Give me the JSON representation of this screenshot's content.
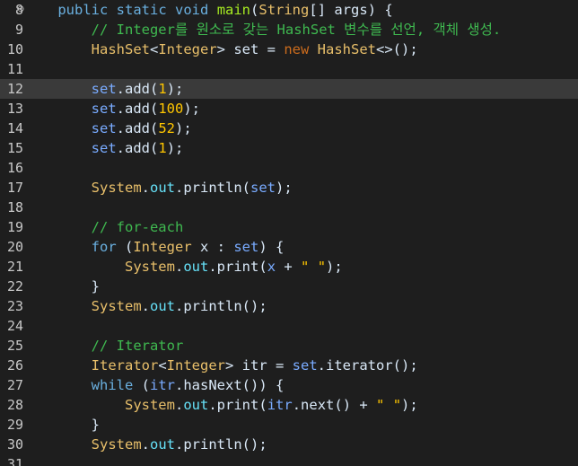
{
  "editor": {
    "lines": [
      {
        "num": "8",
        "marker": "⊖",
        "current": false,
        "tokens": [
          {
            "t": "    ",
            "c": "plain"
          },
          {
            "t": "public",
            "c": "keyword2"
          },
          {
            "t": " ",
            "c": "plain"
          },
          {
            "t": "static",
            "c": "keyword2"
          },
          {
            "t": " ",
            "c": "plain"
          },
          {
            "t": "void",
            "c": "keyword2"
          },
          {
            "t": " ",
            "c": "plain"
          },
          {
            "t": "main",
            "c": "method"
          },
          {
            "t": "(",
            "c": "plain"
          },
          {
            "t": "String",
            "c": "type"
          },
          {
            "t": "[] ",
            "c": "plain"
          },
          {
            "t": "args",
            "c": "default"
          },
          {
            "t": ") {",
            "c": "plain"
          }
        ]
      },
      {
        "num": "9",
        "marker": "",
        "current": false,
        "tokens": [
          {
            "t": "        ",
            "c": "plain"
          },
          {
            "t": "// Integer를 원소로 갖는 HashSet 변수를 선언, 객체 생성.",
            "c": "comment"
          }
        ]
      },
      {
        "num": "10",
        "marker": "",
        "current": false,
        "tokens": [
          {
            "t": "        ",
            "c": "plain"
          },
          {
            "t": "HashSet",
            "c": "type"
          },
          {
            "t": "<",
            "c": "plain"
          },
          {
            "t": "Integer",
            "c": "type"
          },
          {
            "t": "> ",
            "c": "plain"
          },
          {
            "t": "set",
            "c": "default"
          },
          {
            "t": " = ",
            "c": "plain"
          },
          {
            "t": "new",
            "c": "keyword"
          },
          {
            "t": " ",
            "c": "plain"
          },
          {
            "t": "HashSet",
            "c": "type"
          },
          {
            "t": "<>();",
            "c": "plain"
          }
        ]
      },
      {
        "num": "11",
        "marker": "",
        "current": false,
        "tokens": []
      },
      {
        "num": "12",
        "marker": "",
        "current": true,
        "tokens": [
          {
            "t": "        ",
            "c": "plain"
          },
          {
            "t": "set",
            "c": "var"
          },
          {
            "t": ".",
            "c": "plain"
          },
          {
            "t": "add",
            "c": "default"
          },
          {
            "t": "(",
            "c": "plain"
          },
          {
            "t": "1",
            "c": "number"
          },
          {
            "t": ");",
            "c": "plain"
          }
        ]
      },
      {
        "num": "13",
        "marker": "",
        "current": false,
        "tokens": [
          {
            "t": "        ",
            "c": "plain"
          },
          {
            "t": "set",
            "c": "var"
          },
          {
            "t": ".",
            "c": "plain"
          },
          {
            "t": "add",
            "c": "default"
          },
          {
            "t": "(",
            "c": "plain"
          },
          {
            "t": "100",
            "c": "number"
          },
          {
            "t": ");",
            "c": "plain"
          }
        ]
      },
      {
        "num": "14",
        "marker": "",
        "current": false,
        "tokens": [
          {
            "t": "        ",
            "c": "plain"
          },
          {
            "t": "set",
            "c": "var"
          },
          {
            "t": ".",
            "c": "plain"
          },
          {
            "t": "add",
            "c": "default"
          },
          {
            "t": "(",
            "c": "plain"
          },
          {
            "t": "52",
            "c": "number"
          },
          {
            "t": ");",
            "c": "plain"
          }
        ]
      },
      {
        "num": "15",
        "marker": "",
        "current": false,
        "tokens": [
          {
            "t": "        ",
            "c": "plain"
          },
          {
            "t": "set",
            "c": "var"
          },
          {
            "t": ".",
            "c": "plain"
          },
          {
            "t": "add",
            "c": "default"
          },
          {
            "t": "(",
            "c": "plain"
          },
          {
            "t": "1",
            "c": "number"
          },
          {
            "t": ");",
            "c": "plain"
          }
        ]
      },
      {
        "num": "16",
        "marker": "",
        "current": false,
        "tokens": []
      },
      {
        "num": "17",
        "marker": "",
        "current": false,
        "tokens": [
          {
            "t": "        ",
            "c": "plain"
          },
          {
            "t": "System",
            "c": "type"
          },
          {
            "t": ".",
            "c": "plain"
          },
          {
            "t": "out",
            "c": "field"
          },
          {
            "t": ".",
            "c": "plain"
          },
          {
            "t": "println",
            "c": "default"
          },
          {
            "t": "(",
            "c": "plain"
          },
          {
            "t": "set",
            "c": "var"
          },
          {
            "t": ");",
            "c": "plain"
          }
        ]
      },
      {
        "num": "18",
        "marker": "",
        "current": false,
        "tokens": []
      },
      {
        "num": "19",
        "marker": "",
        "current": false,
        "tokens": [
          {
            "t": "        ",
            "c": "plain"
          },
          {
            "t": "// for-each",
            "c": "comment"
          }
        ]
      },
      {
        "num": "20",
        "marker": "",
        "current": false,
        "tokens": [
          {
            "t": "        ",
            "c": "plain"
          },
          {
            "t": "for",
            "c": "keyword2"
          },
          {
            "t": " (",
            "c": "plain"
          },
          {
            "t": "Integer",
            "c": "type"
          },
          {
            "t": " ",
            "c": "plain"
          },
          {
            "t": "x",
            "c": "default"
          },
          {
            "t": " : ",
            "c": "plain"
          },
          {
            "t": "set",
            "c": "var"
          },
          {
            "t": ") {",
            "c": "plain"
          }
        ]
      },
      {
        "num": "21",
        "marker": "",
        "current": false,
        "tokens": [
          {
            "t": "            ",
            "c": "plain"
          },
          {
            "t": "System",
            "c": "type"
          },
          {
            "t": ".",
            "c": "plain"
          },
          {
            "t": "out",
            "c": "field"
          },
          {
            "t": ".",
            "c": "plain"
          },
          {
            "t": "print",
            "c": "default"
          },
          {
            "t": "(",
            "c": "plain"
          },
          {
            "t": "x",
            "c": "var"
          },
          {
            "t": " + ",
            "c": "plain"
          },
          {
            "t": "\" \"",
            "c": "string"
          },
          {
            "t": ");",
            "c": "plain"
          }
        ]
      },
      {
        "num": "22",
        "marker": "",
        "current": false,
        "tokens": [
          {
            "t": "        ",
            "c": "plain"
          },
          {
            "t": "}",
            "c": "plain"
          }
        ]
      },
      {
        "num": "23",
        "marker": "",
        "current": false,
        "tokens": [
          {
            "t": "        ",
            "c": "plain"
          },
          {
            "t": "System",
            "c": "type"
          },
          {
            "t": ".",
            "c": "plain"
          },
          {
            "t": "out",
            "c": "field"
          },
          {
            "t": ".",
            "c": "plain"
          },
          {
            "t": "println",
            "c": "default"
          },
          {
            "t": "();",
            "c": "plain"
          }
        ]
      },
      {
        "num": "24",
        "marker": "",
        "current": false,
        "tokens": []
      },
      {
        "num": "25",
        "marker": "",
        "current": false,
        "tokens": [
          {
            "t": "        ",
            "c": "plain"
          },
          {
            "t": "// Iterator",
            "c": "comment"
          }
        ]
      },
      {
        "num": "26",
        "marker": "",
        "current": false,
        "tokens": [
          {
            "t": "        ",
            "c": "plain"
          },
          {
            "t": "Iterator",
            "c": "type"
          },
          {
            "t": "<",
            "c": "plain"
          },
          {
            "t": "Integer",
            "c": "type"
          },
          {
            "t": "> ",
            "c": "plain"
          },
          {
            "t": "itr",
            "c": "default"
          },
          {
            "t": " = ",
            "c": "plain"
          },
          {
            "t": "set",
            "c": "var"
          },
          {
            "t": ".",
            "c": "plain"
          },
          {
            "t": "iterator",
            "c": "default"
          },
          {
            "t": "();",
            "c": "plain"
          }
        ]
      },
      {
        "num": "27",
        "marker": "",
        "current": false,
        "tokens": [
          {
            "t": "        ",
            "c": "plain"
          },
          {
            "t": "while",
            "c": "keyword2"
          },
          {
            "t": " (",
            "c": "plain"
          },
          {
            "t": "itr",
            "c": "var"
          },
          {
            "t": ".",
            "c": "plain"
          },
          {
            "t": "hasNext",
            "c": "default"
          },
          {
            "t": "()) {",
            "c": "plain"
          }
        ]
      },
      {
        "num": "28",
        "marker": "",
        "current": false,
        "tokens": [
          {
            "t": "            ",
            "c": "plain"
          },
          {
            "t": "System",
            "c": "type"
          },
          {
            "t": ".",
            "c": "plain"
          },
          {
            "t": "out",
            "c": "field"
          },
          {
            "t": ".",
            "c": "plain"
          },
          {
            "t": "print",
            "c": "default"
          },
          {
            "t": "(",
            "c": "plain"
          },
          {
            "t": "itr",
            "c": "var"
          },
          {
            "t": ".",
            "c": "plain"
          },
          {
            "t": "next",
            "c": "default"
          },
          {
            "t": "() + ",
            "c": "plain"
          },
          {
            "t": "\" \"",
            "c": "string"
          },
          {
            "t": ");",
            "c": "plain"
          }
        ]
      },
      {
        "num": "29",
        "marker": "",
        "current": false,
        "tokens": [
          {
            "t": "        ",
            "c": "plain"
          },
          {
            "t": "}",
            "c": "plain"
          }
        ]
      },
      {
        "num": "30",
        "marker": "",
        "current": false,
        "tokens": [
          {
            "t": "        ",
            "c": "plain"
          },
          {
            "t": "System",
            "c": "type"
          },
          {
            "t": ".",
            "c": "plain"
          },
          {
            "t": "out",
            "c": "field"
          },
          {
            "t": ".",
            "c": "plain"
          },
          {
            "t": "println",
            "c": "default"
          },
          {
            "t": "();",
            "c": "plain"
          }
        ]
      },
      {
        "num": "31",
        "marker": "",
        "current": false,
        "tokens": []
      }
    ]
  },
  "colors": {
    "background": "#1e1e1e",
    "current_line": "#3a3a3a",
    "line_number": "#c8c8c8"
  }
}
